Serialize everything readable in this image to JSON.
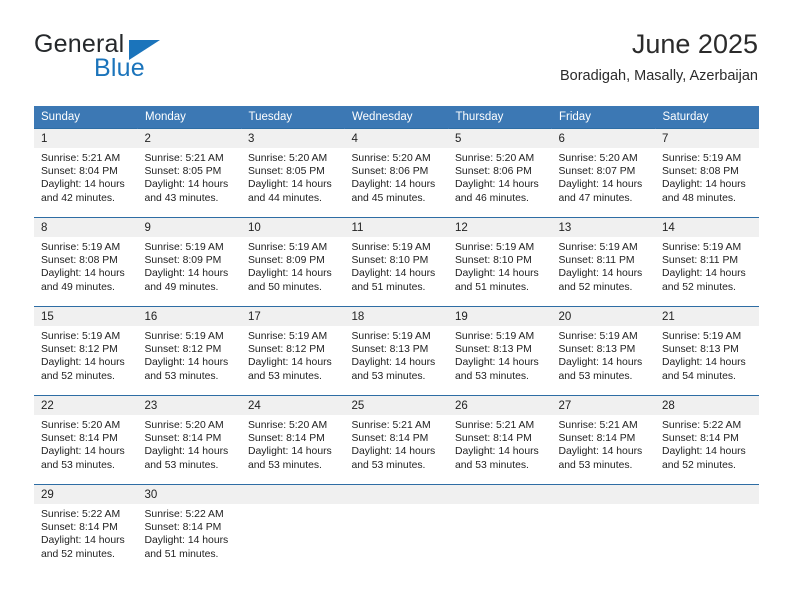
{
  "brand": {
    "name_top": "General",
    "name_bottom": "Blue",
    "accent_color": "#1b74bb"
  },
  "header": {
    "title": "June 2025",
    "subtitle": "Boradigah, Masally, Azerbaijan"
  },
  "theme": {
    "header_row_bg": "#3c78b4",
    "daynum_bg": "#f0f0f0",
    "separator": "#2e6da4",
    "text": "#222222"
  },
  "weekday_headers": [
    "Sunday",
    "Monday",
    "Tuesday",
    "Wednesday",
    "Thursday",
    "Friday",
    "Saturday"
  ],
  "weeks": [
    [
      {
        "day": "1",
        "sunrise": "Sunrise: 5:21 AM",
        "sunset": "Sunset: 8:04 PM",
        "daylight_line1": "Daylight: 14 hours",
        "daylight_line2": "and 42 minutes."
      },
      {
        "day": "2",
        "sunrise": "Sunrise: 5:21 AM",
        "sunset": "Sunset: 8:05 PM",
        "daylight_line1": "Daylight: 14 hours",
        "daylight_line2": "and 43 minutes."
      },
      {
        "day": "3",
        "sunrise": "Sunrise: 5:20 AM",
        "sunset": "Sunset: 8:05 PM",
        "daylight_line1": "Daylight: 14 hours",
        "daylight_line2": "and 44 minutes."
      },
      {
        "day": "4",
        "sunrise": "Sunrise: 5:20 AM",
        "sunset": "Sunset: 8:06 PM",
        "daylight_line1": "Daylight: 14 hours",
        "daylight_line2": "and 45 minutes."
      },
      {
        "day": "5",
        "sunrise": "Sunrise: 5:20 AM",
        "sunset": "Sunset: 8:06 PM",
        "daylight_line1": "Daylight: 14 hours",
        "daylight_line2": "and 46 minutes."
      },
      {
        "day": "6",
        "sunrise": "Sunrise: 5:20 AM",
        "sunset": "Sunset: 8:07 PM",
        "daylight_line1": "Daylight: 14 hours",
        "daylight_line2": "and 47 minutes."
      },
      {
        "day": "7",
        "sunrise": "Sunrise: 5:19 AM",
        "sunset": "Sunset: 8:08 PM",
        "daylight_line1": "Daylight: 14 hours",
        "daylight_line2": "and 48 minutes."
      }
    ],
    [
      {
        "day": "8",
        "sunrise": "Sunrise: 5:19 AM",
        "sunset": "Sunset: 8:08 PM",
        "daylight_line1": "Daylight: 14 hours",
        "daylight_line2": "and 49 minutes."
      },
      {
        "day": "9",
        "sunrise": "Sunrise: 5:19 AM",
        "sunset": "Sunset: 8:09 PM",
        "daylight_line1": "Daylight: 14 hours",
        "daylight_line2": "and 49 minutes."
      },
      {
        "day": "10",
        "sunrise": "Sunrise: 5:19 AM",
        "sunset": "Sunset: 8:09 PM",
        "daylight_line1": "Daylight: 14 hours",
        "daylight_line2": "and 50 minutes."
      },
      {
        "day": "11",
        "sunrise": "Sunrise: 5:19 AM",
        "sunset": "Sunset: 8:10 PM",
        "daylight_line1": "Daylight: 14 hours",
        "daylight_line2": "and 51 minutes."
      },
      {
        "day": "12",
        "sunrise": "Sunrise: 5:19 AM",
        "sunset": "Sunset: 8:10 PM",
        "daylight_line1": "Daylight: 14 hours",
        "daylight_line2": "and 51 minutes."
      },
      {
        "day": "13",
        "sunrise": "Sunrise: 5:19 AM",
        "sunset": "Sunset: 8:11 PM",
        "daylight_line1": "Daylight: 14 hours",
        "daylight_line2": "and 52 minutes."
      },
      {
        "day": "14",
        "sunrise": "Sunrise: 5:19 AM",
        "sunset": "Sunset: 8:11 PM",
        "daylight_line1": "Daylight: 14 hours",
        "daylight_line2": "and 52 minutes."
      }
    ],
    [
      {
        "day": "15",
        "sunrise": "Sunrise: 5:19 AM",
        "sunset": "Sunset: 8:12 PM",
        "daylight_line1": "Daylight: 14 hours",
        "daylight_line2": "and 52 minutes."
      },
      {
        "day": "16",
        "sunrise": "Sunrise: 5:19 AM",
        "sunset": "Sunset: 8:12 PM",
        "daylight_line1": "Daylight: 14 hours",
        "daylight_line2": "and 53 minutes."
      },
      {
        "day": "17",
        "sunrise": "Sunrise: 5:19 AM",
        "sunset": "Sunset: 8:12 PM",
        "daylight_line1": "Daylight: 14 hours",
        "daylight_line2": "and 53 minutes."
      },
      {
        "day": "18",
        "sunrise": "Sunrise: 5:19 AM",
        "sunset": "Sunset: 8:13 PM",
        "daylight_line1": "Daylight: 14 hours",
        "daylight_line2": "and 53 minutes."
      },
      {
        "day": "19",
        "sunrise": "Sunrise: 5:19 AM",
        "sunset": "Sunset: 8:13 PM",
        "daylight_line1": "Daylight: 14 hours",
        "daylight_line2": "and 53 minutes."
      },
      {
        "day": "20",
        "sunrise": "Sunrise: 5:19 AM",
        "sunset": "Sunset: 8:13 PM",
        "daylight_line1": "Daylight: 14 hours",
        "daylight_line2": "and 53 minutes."
      },
      {
        "day": "21",
        "sunrise": "Sunrise: 5:19 AM",
        "sunset": "Sunset: 8:13 PM",
        "daylight_line1": "Daylight: 14 hours",
        "daylight_line2": "and 54 minutes."
      }
    ],
    [
      {
        "day": "22",
        "sunrise": "Sunrise: 5:20 AM",
        "sunset": "Sunset: 8:14 PM",
        "daylight_line1": "Daylight: 14 hours",
        "daylight_line2": "and 53 minutes."
      },
      {
        "day": "23",
        "sunrise": "Sunrise: 5:20 AM",
        "sunset": "Sunset: 8:14 PM",
        "daylight_line1": "Daylight: 14 hours",
        "daylight_line2": "and 53 minutes."
      },
      {
        "day": "24",
        "sunrise": "Sunrise: 5:20 AM",
        "sunset": "Sunset: 8:14 PM",
        "daylight_line1": "Daylight: 14 hours",
        "daylight_line2": "and 53 minutes."
      },
      {
        "day": "25",
        "sunrise": "Sunrise: 5:21 AM",
        "sunset": "Sunset: 8:14 PM",
        "daylight_line1": "Daylight: 14 hours",
        "daylight_line2": "and 53 minutes."
      },
      {
        "day": "26",
        "sunrise": "Sunrise: 5:21 AM",
        "sunset": "Sunset: 8:14 PM",
        "daylight_line1": "Daylight: 14 hours",
        "daylight_line2": "and 53 minutes."
      },
      {
        "day": "27",
        "sunrise": "Sunrise: 5:21 AM",
        "sunset": "Sunset: 8:14 PM",
        "daylight_line1": "Daylight: 14 hours",
        "daylight_line2": "and 53 minutes."
      },
      {
        "day": "28",
        "sunrise": "Sunrise: 5:22 AM",
        "sunset": "Sunset: 8:14 PM",
        "daylight_line1": "Daylight: 14 hours",
        "daylight_line2": "and 52 minutes."
      }
    ],
    [
      {
        "day": "29",
        "sunrise": "Sunrise: 5:22 AM",
        "sunset": "Sunset: 8:14 PM",
        "daylight_line1": "Daylight: 14 hours",
        "daylight_line2": "and 52 minutes."
      },
      {
        "day": "30",
        "sunrise": "Sunrise: 5:22 AM",
        "sunset": "Sunset: 8:14 PM",
        "daylight_line1": "Daylight: 14 hours",
        "daylight_line2": "and 51 minutes."
      },
      {
        "day": "",
        "sunrise": "",
        "sunset": "",
        "daylight_line1": "",
        "daylight_line2": ""
      },
      {
        "day": "",
        "sunrise": "",
        "sunset": "",
        "daylight_line1": "",
        "daylight_line2": ""
      },
      {
        "day": "",
        "sunrise": "",
        "sunset": "",
        "daylight_line1": "",
        "daylight_line2": ""
      },
      {
        "day": "",
        "sunrise": "",
        "sunset": "",
        "daylight_line1": "",
        "daylight_line2": ""
      },
      {
        "day": "",
        "sunrise": "",
        "sunset": "",
        "daylight_line1": "",
        "daylight_line2": ""
      }
    ]
  ]
}
